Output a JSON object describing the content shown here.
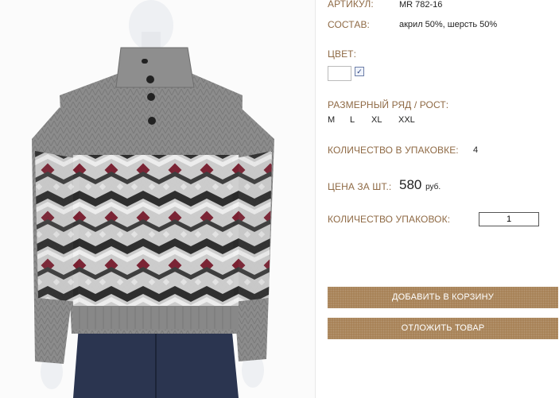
{
  "product": {
    "image_alt": "gray knitted sweater with zigzag pattern on mannequin",
    "article_label": "АРТИКУЛ:",
    "article_value": "MR 782-16",
    "composition_label": "СОСТАВ:",
    "composition_value": "акрил 50%, шерсть 50%",
    "color_label": "ЦВЕТ:",
    "color_checked": true,
    "size_label": "РАЗМЕРНЫЙ РЯД / РОСТ:",
    "sizes": [
      "M",
      "L",
      "XL",
      "XXL"
    ],
    "pack_qty_label": "КОЛИЧЕСТВО В УПАКОВКЕ:",
    "pack_qty_value": "4",
    "price_label": "ЦЕНА ЗА ШТ.:",
    "price_value": "580",
    "price_unit": "руб.",
    "packs_label": "КОЛИЧЕСТВО УПАКОВОК:",
    "packs_value": "1",
    "add_to_cart_label": "ДОБАВИТЬ В КОРЗИНУ",
    "defer_label": "ОТЛОЖИТЬ ТОВАР"
  },
  "colors": {
    "label": "#8f6a45",
    "button": "#a57f52",
    "sweater_gray": "#8a8a8a",
    "sweater_red": "#7a1f30",
    "jeans": "#2b3550"
  }
}
